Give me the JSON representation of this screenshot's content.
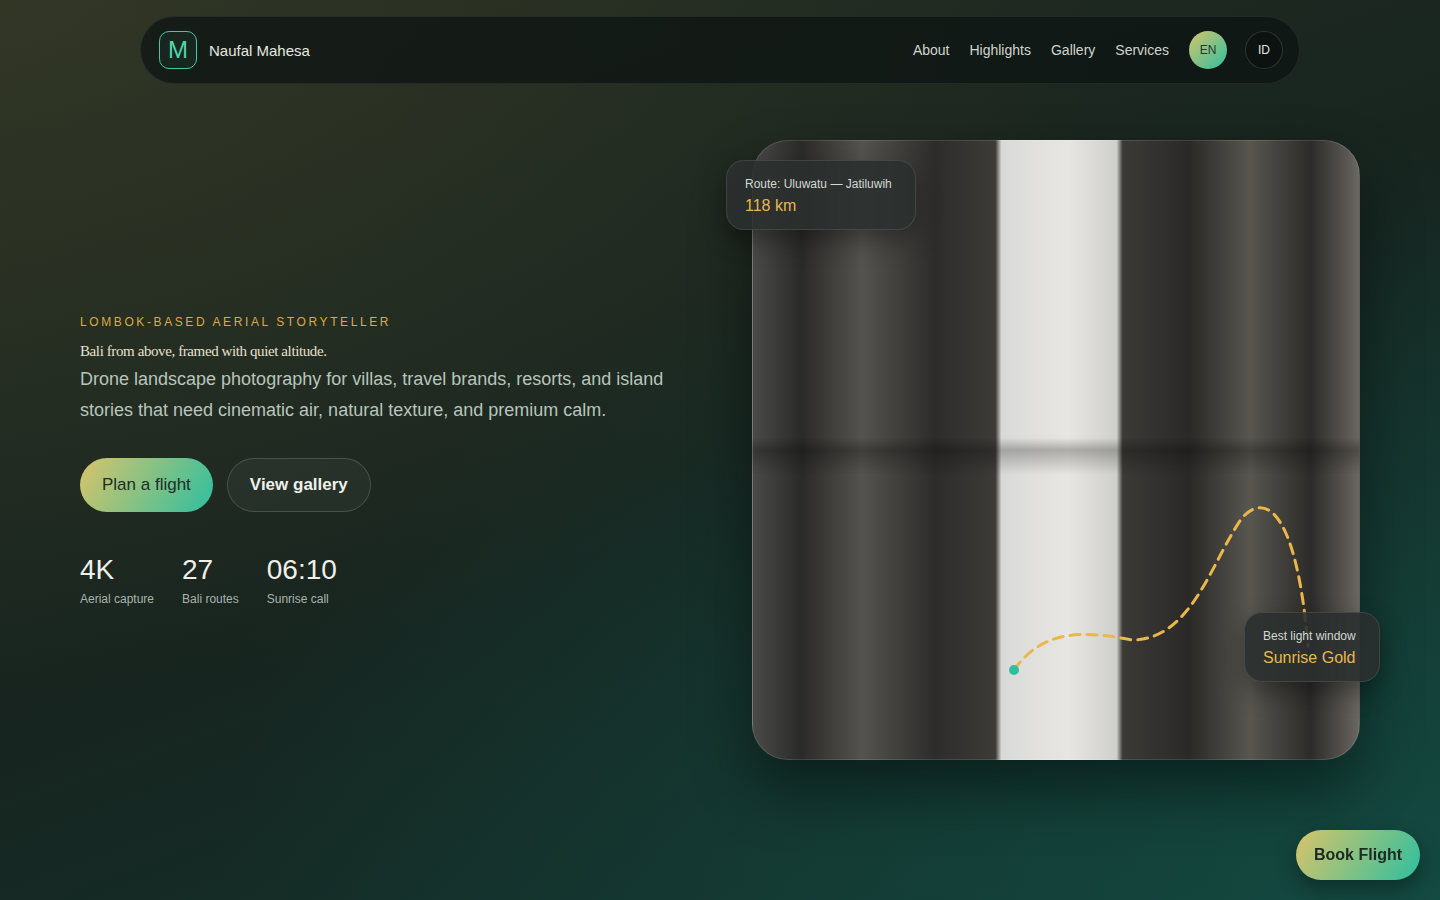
{
  "nav": {
    "logo_letter": "M",
    "brand": "Naufal Mahesa",
    "links": [
      {
        "label": "About"
      },
      {
        "label": "Highlights"
      },
      {
        "label": "Gallery"
      },
      {
        "label": "Services"
      }
    ],
    "languages": [
      {
        "label": "EN",
        "selected": true
      },
      {
        "label": "ID",
        "selected": false
      }
    ]
  },
  "hero": {
    "eyebrow": "LOMBOK-BASED AERIAL STORYTELLER",
    "tagline": "Bali from above, framed with quiet altitude.",
    "description": "Drone landscape photography for villas, travel brands, resorts, and island stories that need cinematic air, natural texture, and premium calm.",
    "buttons": [
      {
        "label": "Plan a flight",
        "kind": "primary"
      },
      {
        "label": "View gallery",
        "kind": "secondary"
      }
    ],
    "stats": [
      {
        "value": "4K",
        "label": "Aerial capture"
      },
      {
        "value": "27",
        "label": "Bali routes"
      },
      {
        "value": "06:10",
        "label": "Sunrise call"
      }
    ]
  },
  "photo_card": {
    "route": {
      "label": "Route: Uluwatu — Jatiluwih",
      "value": "118 km"
    },
    "light": {
      "label": "Best light window",
      "value": "Sunrise Gold"
    }
  },
  "floating_button": {
    "label": "Book Flight"
  }
}
